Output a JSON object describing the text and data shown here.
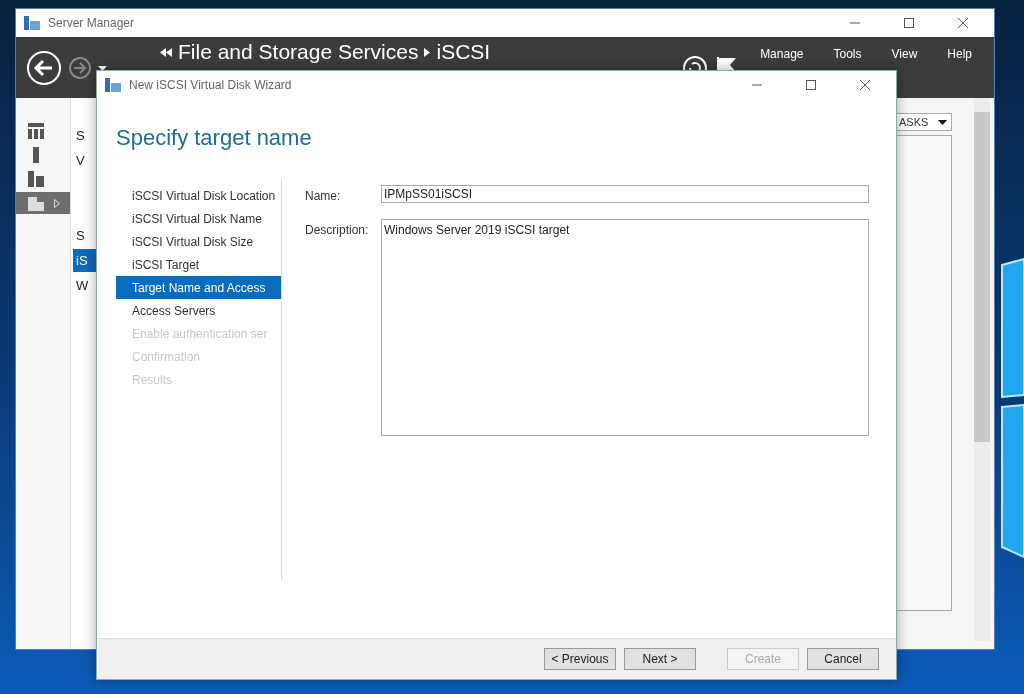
{
  "server_manager": {
    "title": "Server Manager",
    "breadcrumb": [
      "File and Storage Services",
      "iSCSI"
    ],
    "menu": [
      "Manage",
      "Tools",
      "View",
      "Help"
    ],
    "nav_items": [
      {
        "selected": false
      },
      {
        "selected": false
      },
      {
        "selected": false
      },
      {
        "selected": true
      }
    ],
    "side_groups": [
      [
        {
          "label": "S",
          "selected": false
        },
        {
          "label": "V",
          "selected": false
        }
      ],
      [
        {
          "label": "S",
          "selected": false
        },
        {
          "label": "iS",
          "selected": true
        },
        {
          "label": "W",
          "selected": false
        }
      ]
    ],
    "tasks_button": "ASKS"
  },
  "wizard": {
    "title": "New iSCSI Virtual Disk Wizard",
    "heading": "Specify target name",
    "steps": [
      {
        "label": "iSCSI Virtual Disk Location",
        "selected": false,
        "disabled": false
      },
      {
        "label": "iSCSI Virtual Disk Name",
        "selected": false,
        "disabled": false
      },
      {
        "label": "iSCSI Virtual Disk Size",
        "selected": false,
        "disabled": false
      },
      {
        "label": "iSCSI Target",
        "selected": false,
        "disabled": false
      },
      {
        "label": "Target Name and Access",
        "selected": true,
        "disabled": false
      },
      {
        "label": "Access Servers",
        "selected": false,
        "disabled": false
      },
      {
        "label": "Enable authentication ser",
        "selected": false,
        "disabled": true
      },
      {
        "label": "Confirmation",
        "selected": false,
        "disabled": true
      },
      {
        "label": "Results",
        "selected": false,
        "disabled": true
      }
    ],
    "name_label": "Name:",
    "name_value": "IPMpSS01iSCSI",
    "description_label": "Description:",
    "description_value": "Windows Server 2019 iSCSI target",
    "buttons": [
      {
        "label": "< Previous",
        "disabled": false
      },
      {
        "label": "Next >",
        "disabled": false
      },
      {
        "label": "Create",
        "disabled": true
      },
      {
        "label": "Cancel",
        "disabled": false
      }
    ]
  }
}
